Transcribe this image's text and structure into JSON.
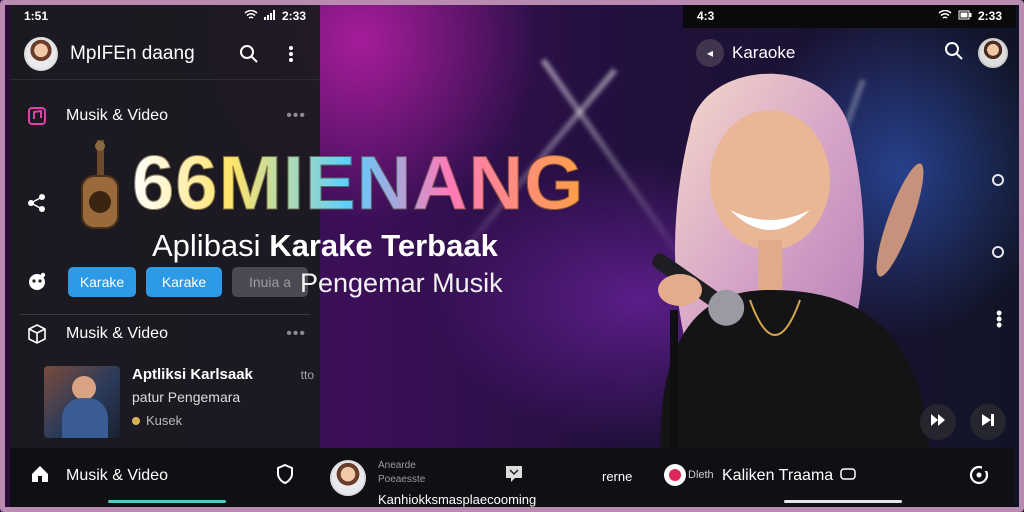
{
  "left_panel": {
    "status": {
      "time": "1:51",
      "right": "2:33"
    },
    "header": {
      "title": "MpIFEn daang"
    },
    "sections": [
      {
        "label": "Musik & Video"
      },
      {
        "label": "Musik & Video"
      }
    ],
    "chips": [
      "Karake",
      "Karake",
      "Inuia a"
    ],
    "media_card": {
      "title": "Aptliksi Karlsaak",
      "subtitle": "patur Pengemara",
      "meta": "Kusek",
      "tag": "tto"
    }
  },
  "hero": {
    "logo": "66MIENANG",
    "subtitle_pre": "Aplibasi ",
    "subtitle_bold": "Karake Terbaak",
    "tagline": "Pengemar Musik"
  },
  "right_panel": {
    "status": {
      "time": "4:3",
      "right": "2:33"
    },
    "header": {
      "title": "Karaoke"
    }
  },
  "bottom_nav": {
    "home_label": "Musik & Video",
    "profile_small": "Anearde",
    "profile_small2": "Poeaesste",
    "caption": "Kanhiokksmasplaecooming",
    "item_text": "rerne",
    "badge_text": "Dleth",
    "account_label": "Kaliken Traama"
  }
}
